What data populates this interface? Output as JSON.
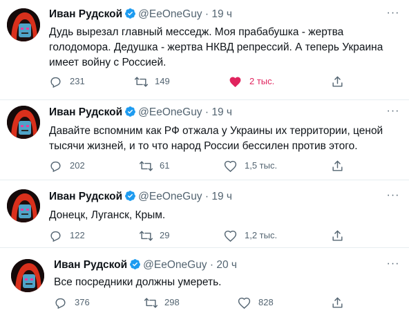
{
  "tweets": [
    {
      "author": "Иван Рудской",
      "handle": "@EeOneGuy",
      "dot": "·",
      "time": "19 ч",
      "lines": [
        "Дудь вырезал главный месседж. Моя прабабушка - жертва",
        "голодомора. Дедушка - жертва НКВД репрессий. А теперь Украина",
        "имеет войну с Россией."
      ],
      "replies": "231",
      "retweets": "149",
      "likes": "2 тыс.",
      "liked": true
    },
    {
      "author": "Иван Рудской",
      "handle": "@EeOneGuy",
      "dot": "·",
      "time": "19 ч",
      "lines": [
        "Давайте вспомним как РФ отжала у Украины их территории, ценой",
        "тысячи жизней, и то что народ России бессилен против этого."
      ],
      "replies": "202",
      "retweets": "61",
      "likes": "1,5 тыс.",
      "liked": false
    },
    {
      "author": "Иван Рудской",
      "handle": "@EeOneGuy",
      "dot": "·",
      "time": "19 ч",
      "lines": [
        "Донецк, Луганск, Крым."
      ],
      "replies": "122",
      "retweets": "29",
      "likes": "1,2 тыс.",
      "liked": false
    },
    {
      "author": "Иван Рудской",
      "handle": "@EeOneGuy",
      "dot": "·",
      "time": "20 ч",
      "lines": [
        "Все посредники должны умереть."
      ],
      "replies": "376",
      "retweets": "298",
      "likes": "828",
      "liked": false
    }
  ],
  "icons": {
    "verified": "verified-badge-icon",
    "more": "more-options-icon",
    "reply": "reply-icon",
    "retweet": "retweet-icon",
    "like": "like-icon",
    "share": "share-icon"
  },
  "colors": {
    "verified": "#1d9bf0",
    "like_active": "#e0245e",
    "secondary_text": "#536471",
    "divider": "#e6ecf0"
  }
}
